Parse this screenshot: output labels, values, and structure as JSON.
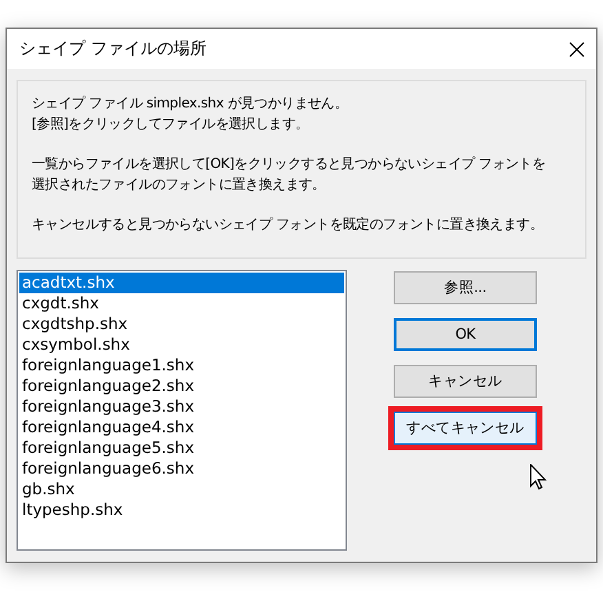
{
  "window": {
    "title": "シェイプ ファイルの場所"
  },
  "message": [
    [
      "シェイプ ファイル simplex.shx が見つかりません。",
      "[参照]をクリックしてファイルを選択します。"
    ],
    [
      "一覧からファイルを選択して[OK]をクリックすると見つからないシェイプ フォントを",
      "選択されたファイルのフォントに置き換えます。"
    ],
    [
      "キャンセルすると見つからないシェイプ フォントを既定のフォントに置き換えます。"
    ]
  ],
  "files": [
    {
      "label": "acadtxt.shx",
      "selected": true
    },
    {
      "label": "cxgdt.shx",
      "selected": false
    },
    {
      "label": "cxgdtshp.shx",
      "selected": false
    },
    {
      "label": "cxsymbol.shx",
      "selected": false
    },
    {
      "label": "foreignlanguage1.shx",
      "selected": false
    },
    {
      "label": "foreignlanguage2.shx",
      "selected": false
    },
    {
      "label": "foreignlanguage3.shx",
      "selected": false
    },
    {
      "label": "foreignlanguage4.shx",
      "selected": false
    },
    {
      "label": "foreignlanguage5.shx",
      "selected": false
    },
    {
      "label": "foreignlanguage6.shx",
      "selected": false
    },
    {
      "label": "gb.shx",
      "selected": false
    },
    {
      "label": "ltypeshp.shx",
      "selected": false
    }
  ],
  "buttons": [
    {
      "label": "参照...",
      "default": false,
      "highlighted": false
    },
    {
      "label": "OK",
      "default": true,
      "highlighted": false
    },
    {
      "label": "キャンセル",
      "default": false,
      "highlighted": false
    },
    {
      "label": "すべてキャンセル",
      "default": false,
      "highlighted": true
    }
  ]
}
